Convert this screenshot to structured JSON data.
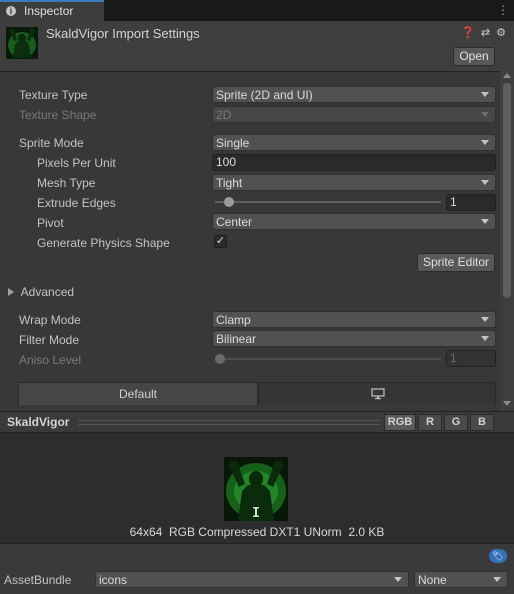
{
  "window": {
    "tab_label": "Inspector"
  },
  "header": {
    "title": "SkaldVigor Import Settings",
    "open_label": "Open",
    "icons": [
      "help-icon",
      "preset-icon",
      "settings-icon"
    ]
  },
  "fields": {
    "texture_type": {
      "label": "Texture Type",
      "value": "Sprite (2D and UI)"
    },
    "texture_shape": {
      "label": "Texture Shape",
      "value": "2D"
    },
    "sprite_mode": {
      "label": "Sprite Mode",
      "value": "Single"
    },
    "pixels_per_unit": {
      "label": "Pixels Per Unit",
      "value": "100"
    },
    "mesh_type": {
      "label": "Mesh Type",
      "value": "Tight"
    },
    "extrude_edges": {
      "label": "Extrude Edges",
      "value": "1",
      "level": 0.04
    },
    "pivot": {
      "label": "Pivot",
      "value": "Center"
    },
    "generate_physics": {
      "label": "Generate Physics Shape",
      "checked": true,
      "glyph": "✓"
    },
    "sprite_editor_label": "Sprite Editor",
    "advanced_label": "Advanced",
    "wrap_mode": {
      "label": "Wrap Mode",
      "value": "Clamp"
    },
    "filter_mode": {
      "label": "Filter Mode",
      "value": "Bilinear"
    },
    "aniso_level": {
      "label": "Aniso Level",
      "value": "1",
      "level": 0.0
    }
  },
  "platform_tabs": {
    "default_label": "Default",
    "standalone_icon": "monitor-icon"
  },
  "preview": {
    "name": "SkaldVigor",
    "channels": [
      "RGB",
      "R",
      "G",
      "B"
    ],
    "info": "64x64  RGB Compressed DXT1 UNorm  2.0 KB"
  },
  "assetbundle": {
    "label": "AssetBundle",
    "name": "icons",
    "variant": "None"
  },
  "colors": {
    "accent": "#3a79bb",
    "background": "#383838",
    "preview_glow": "#3cc83c"
  }
}
